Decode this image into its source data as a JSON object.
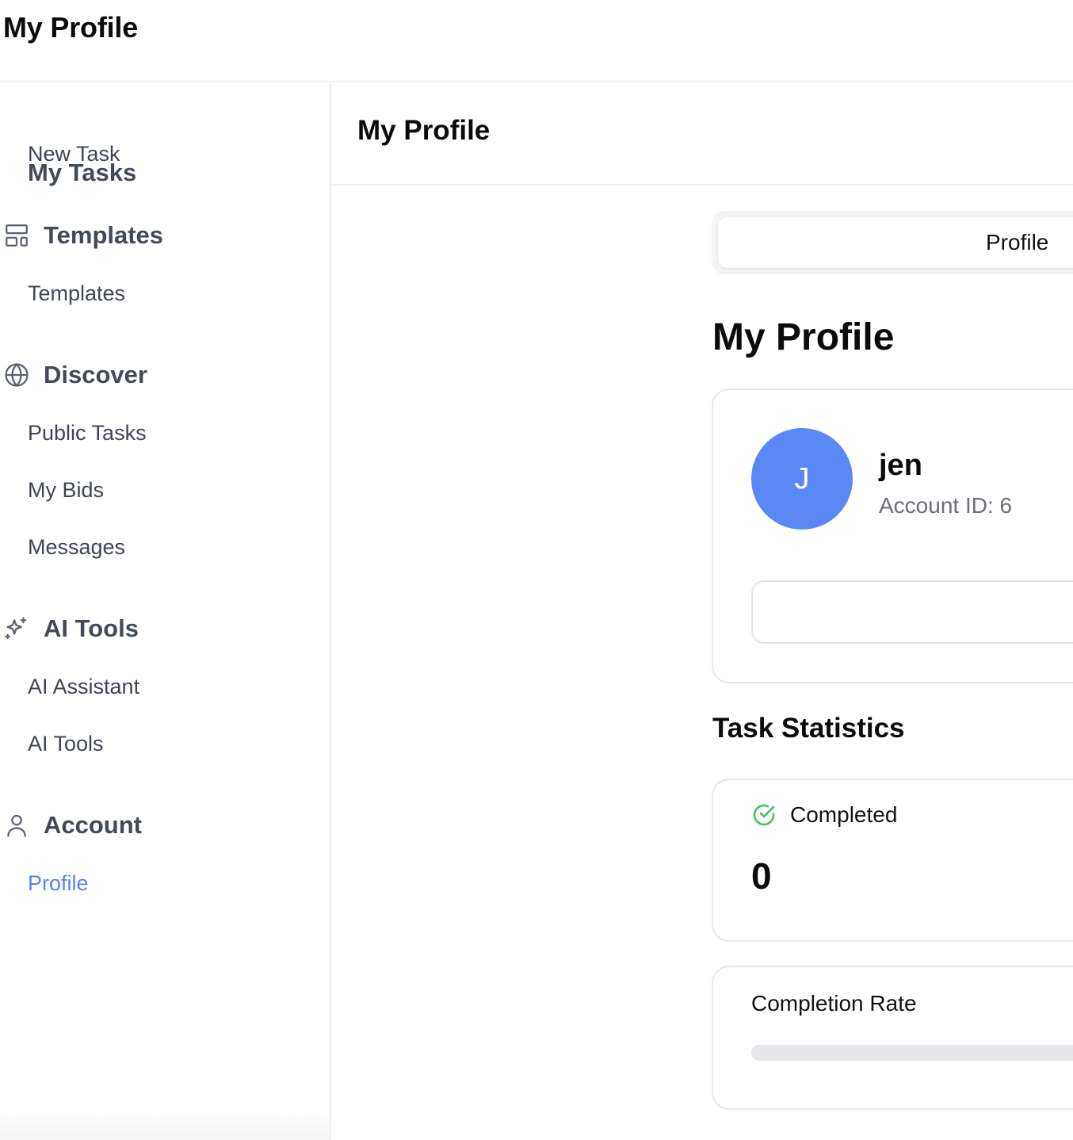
{
  "header": {
    "title": "My Profile"
  },
  "sidebar": {
    "my_tasks": "My Tasks",
    "new_task": "New Task",
    "sections": [
      {
        "label": "Templates",
        "icon": "layout-template-icon",
        "items": [
          "Templates"
        ]
      },
      {
        "label": "Discover",
        "icon": "globe-icon",
        "items": [
          "Public Tasks",
          "My Bids",
          "Messages"
        ]
      },
      {
        "label": "AI Tools",
        "icon": "sparkles-icon",
        "items": [
          "AI Assistant",
          "AI Tools"
        ]
      },
      {
        "label": "Account",
        "icon": "user-icon",
        "items": [
          "Profile"
        ]
      }
    ],
    "active_item": "Profile"
  },
  "main": {
    "header_title": "My Profile",
    "tabs": [
      {
        "label": "Profile",
        "active": true
      }
    ],
    "page_title": "My Profile",
    "profile": {
      "avatar_initial": "J",
      "username": "jen",
      "account_id": "Account ID: 6"
    },
    "stats_title": "Task Statistics",
    "stats": {
      "completed_label": "Completed",
      "completed_value": "0",
      "completion_rate_label": "Completion Rate",
      "completion_rate": 0
    }
  },
  "colors": {
    "accent": "#5a83ef",
    "avatar_bg": "#5b87f5",
    "success": "#4cc06a",
    "sidebar_text": "#3f4552",
    "border": "#e7e8eb"
  }
}
